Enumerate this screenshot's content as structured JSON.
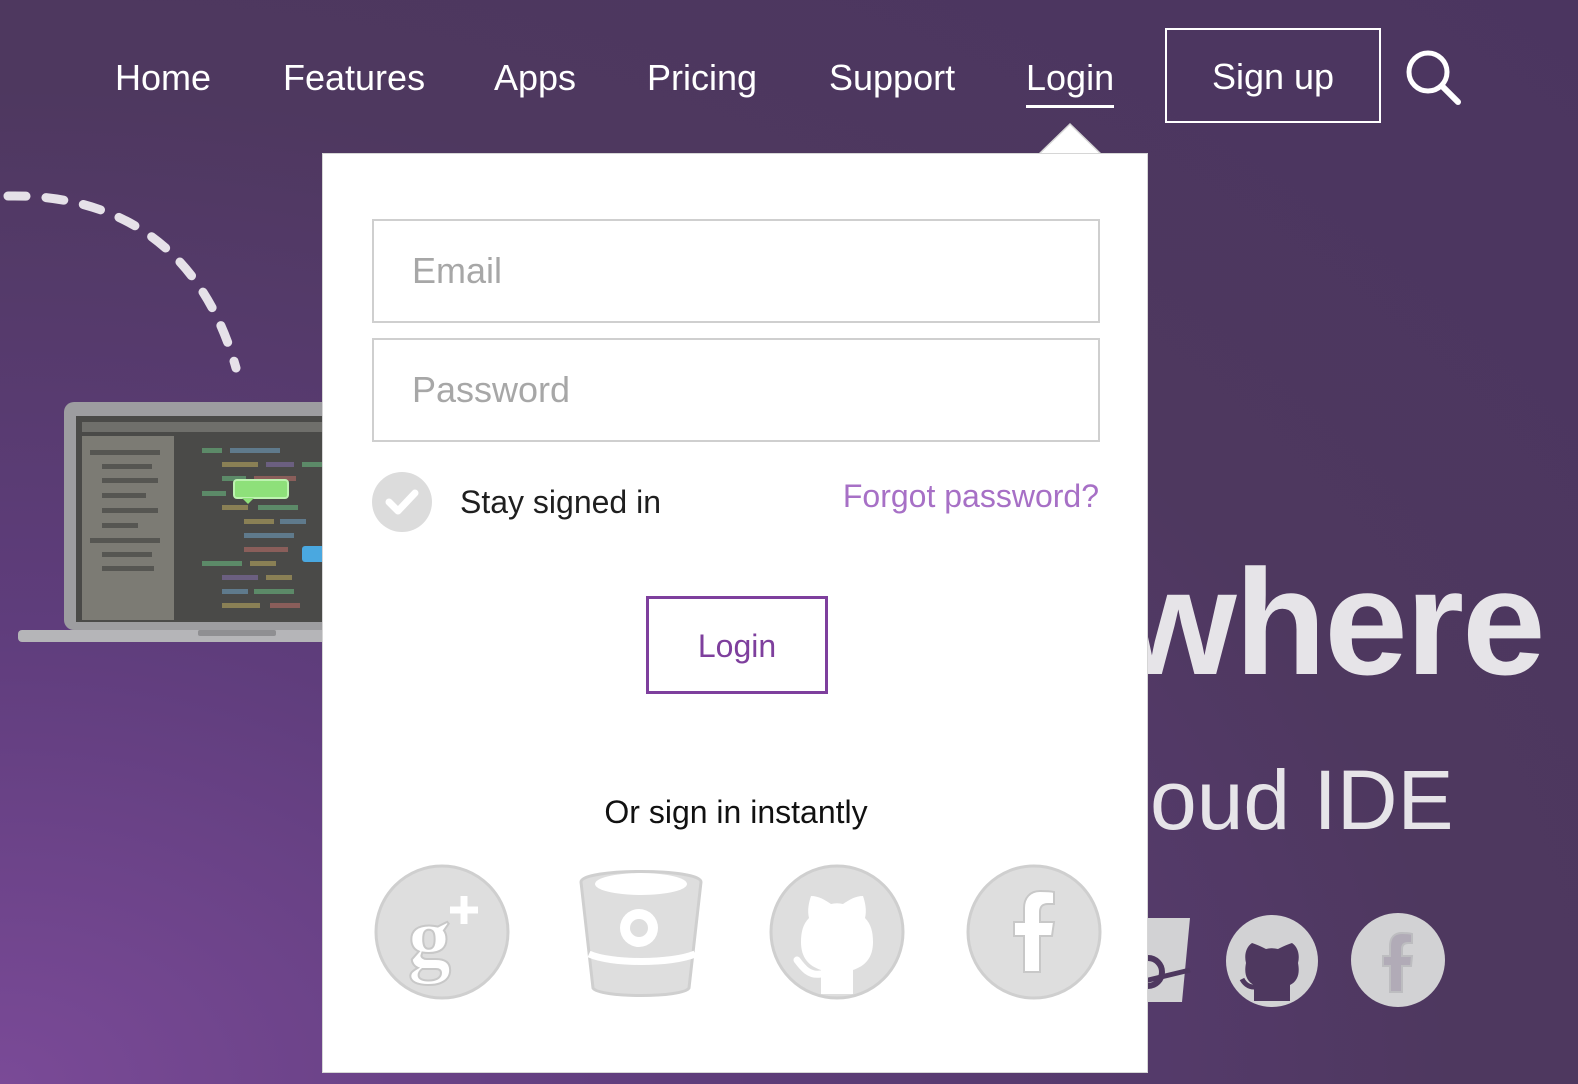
{
  "nav": {
    "items": [
      {
        "label": "Home"
      },
      {
        "label": "Features"
      },
      {
        "label": "Apps"
      },
      {
        "label": "Pricing"
      },
      {
        "label": "Support"
      },
      {
        "label": "Login",
        "active": true
      }
    ],
    "signup_label": "Sign up",
    "search_icon": "search-icon"
  },
  "hero": {
    "title_partial": "where",
    "subtitle_partial": "oud IDE",
    "bg_icons": [
      "bitbucket-icon",
      "github-icon",
      "facebook-icon"
    ]
  },
  "login_dropdown": {
    "email_placeholder": "Email",
    "password_placeholder": "Password",
    "stay_signed_in_label": "Stay signed in",
    "stay_signed_in_checked": true,
    "forgot_password_label": "Forgot password?",
    "login_button_label": "Login",
    "instant_label": "Or sign in instantly",
    "social_providers": [
      "google-plus-icon",
      "bitbucket-icon",
      "github-icon",
      "facebook-icon"
    ]
  },
  "colors": {
    "background": "#4e385f",
    "accent": "#7e3f9d",
    "link": "#a770c6",
    "icon_grey": "#dcdcdc"
  }
}
